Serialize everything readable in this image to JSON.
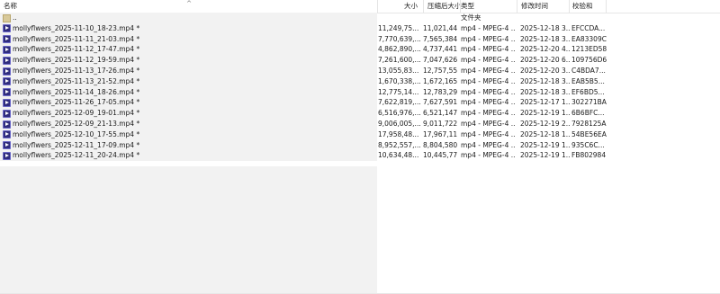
{
  "columns": {
    "name": "名称",
    "size": "大小",
    "packed": "压缩后大小",
    "type": "类型",
    "modified": "修改时间",
    "crc": "校验和"
  },
  "parent_row": {
    "name": "..",
    "type": "文件夹"
  },
  "files": [
    {
      "name": "mollyflwers_2025-11-10_18-23.mp4 *",
      "size": "11,249,75...",
      "packed": "11,021,44...",
      "type": "mp4 - MPEG-4 ...",
      "modified": "2025-12-18 3...",
      "crc": "EFCCDA..."
    },
    {
      "name": "mollyflwers_2025-11-11_21-03.mp4 *",
      "size": "7,770,639,...",
      "packed": "7,565,384,...",
      "type": "mp4 - MPEG-4 ...",
      "modified": "2025-12-18 3...",
      "crc": "EA83309C"
    },
    {
      "name": "mollyflwers_2025-11-12_17-47.mp4 *",
      "size": "4,862,890,...",
      "packed": "4,737,441,...",
      "type": "mp4 - MPEG-4 ...",
      "modified": "2025-12-20 4...",
      "crc": "1213ED58"
    },
    {
      "name": "mollyflwers_2025-11-12_19-59.mp4 *",
      "size": "7,261,600,...",
      "packed": "7,047,626,...",
      "type": "mp4 - MPEG-4 ...",
      "modified": "2025-12-20 6...",
      "crc": "109756D6"
    },
    {
      "name": "mollyflwers_2025-11-13_17-26.mp4 *",
      "size": "13,055,83...",
      "packed": "12,757,55...",
      "type": "mp4 - MPEG-4 ...",
      "modified": "2025-12-20 3...",
      "crc": "C4BDA7..."
    },
    {
      "name": "mollyflwers_2025-11-13_21-52.mp4 *",
      "size": "1,670,338,...",
      "packed": "1,672,165,...",
      "type": "mp4 - MPEG-4 ...",
      "modified": "2025-12-18 3...",
      "crc": "EAB5B5..."
    },
    {
      "name": "mollyflwers_2025-11-14_18-26.mp4 *",
      "size": "12,775,14...",
      "packed": "12,783,29...",
      "type": "mp4 - MPEG-4 ...",
      "modified": "2025-12-18 3...",
      "crc": "EF6BD5..."
    },
    {
      "name": "mollyflwers_2025-11-26_17-05.mp4 *",
      "size": "7,622,819,...",
      "packed": "7,627,591,...",
      "type": "mp4 - MPEG-4 ...",
      "modified": "2025-12-17 1...",
      "crc": "302271BA"
    },
    {
      "name": "mollyflwers_2025-12-09_19-01.mp4 *",
      "size": "6,516,976,...",
      "packed": "6,521,147,...",
      "type": "mp4 - MPEG-4 ...",
      "modified": "2025-12-19 1...",
      "crc": "6B6BFC..."
    },
    {
      "name": "mollyflwers_2025-12-09_21-13.mp4 *",
      "size": "9,006,005,...",
      "packed": "9,011,722,...",
      "type": "mp4 - MPEG-4 ...",
      "modified": "2025-12-19 2...",
      "crc": "7928125A"
    },
    {
      "name": "mollyflwers_2025-12-10_17-55.mp4 *",
      "size": "17,958,48...",
      "packed": "17,967,11...",
      "type": "mp4 - MPEG-4 ...",
      "modified": "2025-12-18 1...",
      "crc": "54BE56EA"
    },
    {
      "name": "mollyflwers_2025-12-11_17-09.mp4 *",
      "size": "8,952,557,...",
      "packed": "8,804,580,...",
      "type": "mp4 - MPEG-4 ...",
      "modified": "2025-12-19 1...",
      "crc": "935C6C..."
    },
    {
      "name": "mollyflwers_2025-12-11_20-24.mp4 *",
      "size": "10,634,48...",
      "packed": "10,445,77...",
      "type": "mp4 - MPEG-4 ...",
      "modified": "2025-12-19 1...",
      "crc": "FB802984"
    }
  ]
}
